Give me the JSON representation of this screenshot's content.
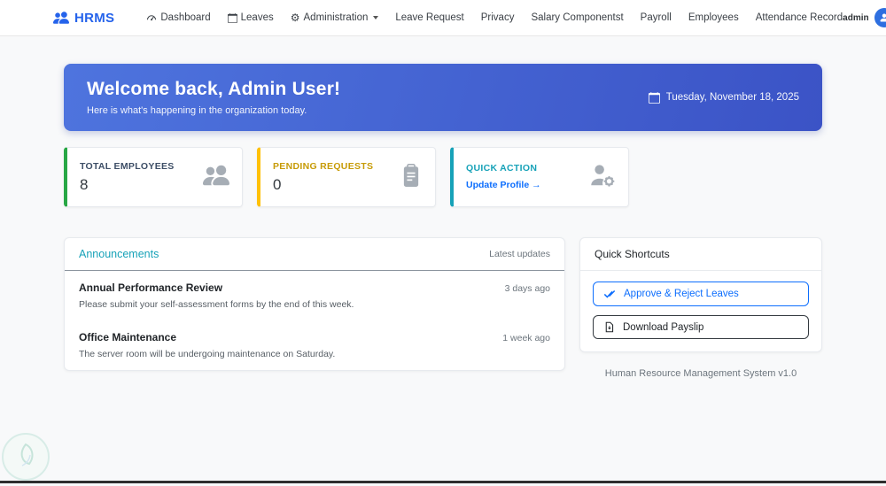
{
  "navbar": {
    "brand": "HRMS",
    "items": [
      {
        "label": "Dashboard"
      },
      {
        "label": "Leaves"
      },
      {
        "label": "Administration"
      },
      {
        "label": "Leave Request"
      },
      {
        "label": "Privacy"
      },
      {
        "label": "Salary Componentst"
      },
      {
        "label": "Payroll"
      },
      {
        "label": "Employees"
      },
      {
        "label": "Attendance Record"
      }
    ],
    "user": {
      "name": "admin"
    }
  },
  "banner": {
    "title": "Welcome back, Admin User!",
    "subtitle": "Here is what's happening in the organization today.",
    "date": "Tuesday, November 18, 2025"
  },
  "stats": [
    {
      "title": "TOTAL EMPLOYEES",
      "value": "8",
      "accent": "#28a745"
    },
    {
      "title": "PENDING REQUESTS",
      "value": "0",
      "accent": "#ffc107"
    },
    {
      "title": "QUICK ACTION",
      "link": "Update Profile →",
      "accent": "#17a2b8"
    }
  ],
  "announcements": {
    "title": "Announcements",
    "subtitle": "Latest updates",
    "items": [
      {
        "title": "Annual Performance Review",
        "body": "Please submit your self-assessment forms by the end of this week.",
        "time": "3 days ago"
      },
      {
        "title": "Office Maintenance",
        "body": "The server room will be undergoing maintenance on Saturday.",
        "time": "1 week ago"
      }
    ]
  },
  "shortcuts": {
    "title": "Quick Shortcuts",
    "buttons": [
      {
        "label": "Approve & Reject Leaves"
      },
      {
        "label": "Download Payslip"
      }
    ]
  },
  "footer": "Human Resource Management System v1.0",
  "colors": {
    "brand_blue": "#2563eb",
    "primary_blue": "#0d6efd",
    "banner_gradient_from": "#4e74de",
    "banner_gradient_to": "#3b53c6",
    "accent_green": "#28a745",
    "accent_yellow": "#ffc107",
    "accent_teal": "#17a2b8"
  }
}
